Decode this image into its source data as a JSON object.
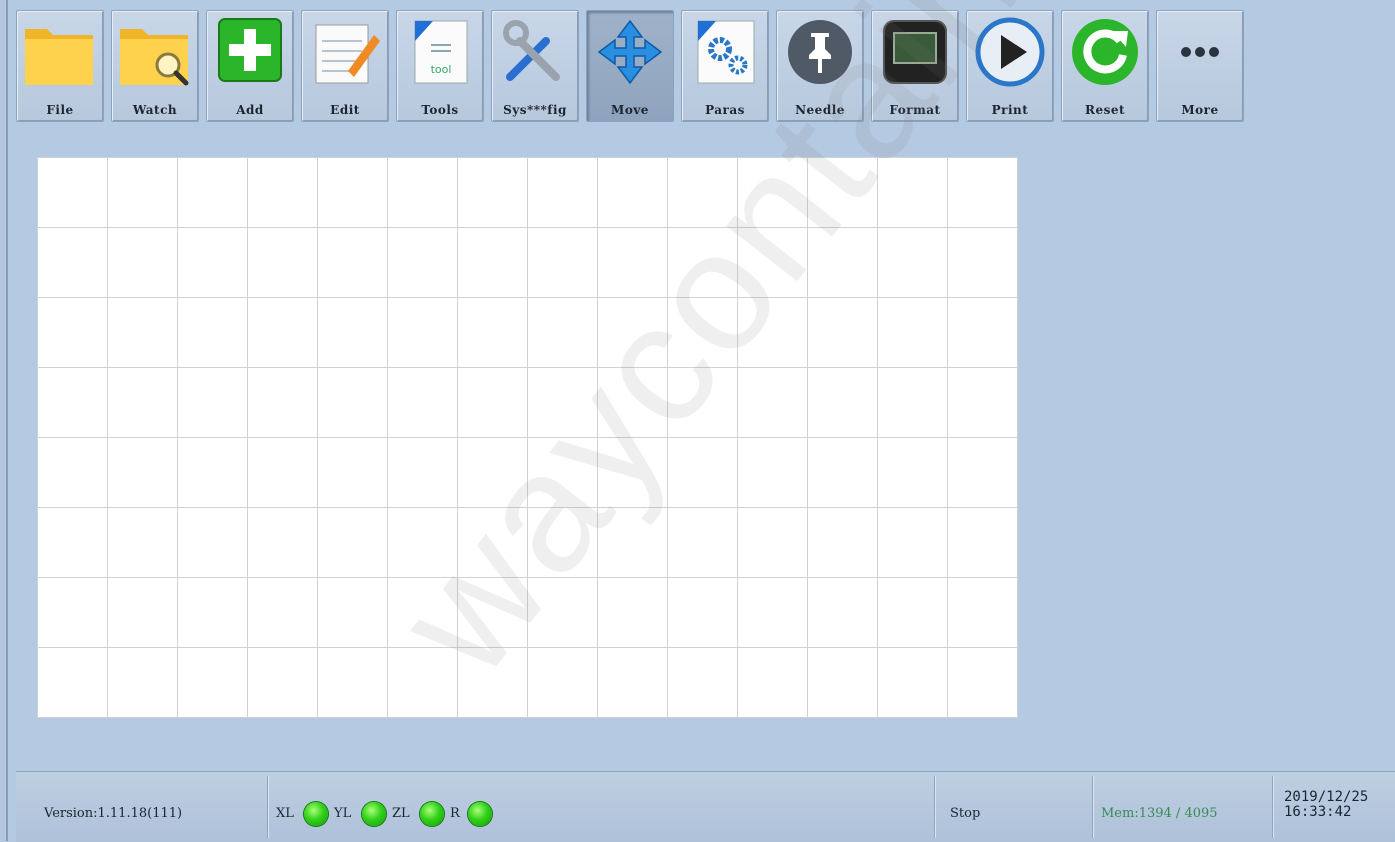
{
  "toolbar": {
    "buttons": [
      {
        "label": "File",
        "icon": "folder-icon"
      },
      {
        "label": "Watch",
        "icon": "folder-magnifier-icon"
      },
      {
        "label": "Add",
        "icon": "plus-icon"
      },
      {
        "label": "Edit",
        "icon": "notepad-pencil-icon"
      },
      {
        "label": "Tools",
        "icon": "tool-document-icon"
      },
      {
        "label": "Sys***fig",
        "icon": "wrench-screwdriver-icon"
      },
      {
        "label": "Move",
        "icon": "move-arrows-icon",
        "active": true
      },
      {
        "label": "Paras",
        "icon": "gears-document-icon"
      },
      {
        "label": "Needle",
        "icon": "pushpin-icon"
      },
      {
        "label": "Format",
        "icon": "monitor-icon"
      },
      {
        "label": "Print",
        "icon": "play-icon"
      },
      {
        "label": "Reset",
        "icon": "refresh-icon"
      },
      {
        "label": "More",
        "icon": "ellipsis-icon"
      }
    ]
  },
  "status": {
    "version": "Version:1.11.18(111)",
    "axes": [
      "XL",
      "YL",
      "ZL",
      "R"
    ],
    "state": "Stop",
    "memory": "Mem:1394 / 4095",
    "date": "2019/12/25",
    "time": "16:33:42"
  },
  "watermark": "waycontainer.com",
  "colors": {
    "background": "#b4c9e2",
    "led": "#33d11a",
    "canvas": "#ffffff"
  }
}
